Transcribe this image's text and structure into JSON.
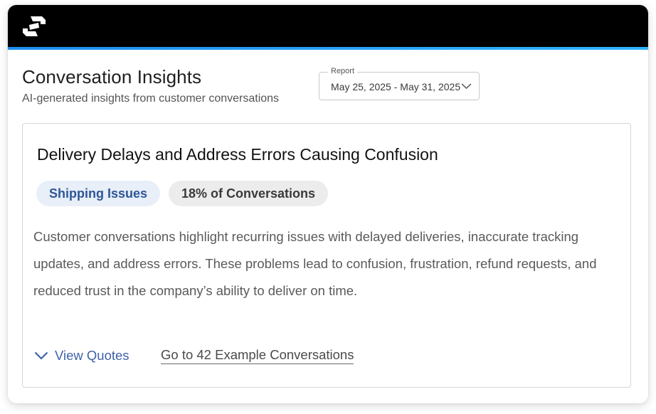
{
  "header": {
    "logo_icon": "brand-logo-icon",
    "accent_color": "#1d8df0"
  },
  "page": {
    "title": "Conversation Insights",
    "subtitle": "AI-generated insights from customer conversations"
  },
  "report": {
    "label": "Report",
    "value": "May 25, 2025 - May 31, 2025",
    "icon": "chevron-down-icon"
  },
  "insight": {
    "title": "Delivery Delays and Address Errors Causing Confusion",
    "category": "Shipping Issues",
    "share": "18% of Conversations",
    "summary": "Customer conversations highlight recurring issues with delayed deliveries, inaccurate tracking updates, and address errors. These problems lead to confusion, frustration, refund requests, and reduced trust in the company’s ability to deliver on time.",
    "view_quotes_label": "View Quotes",
    "view_quotes_icon": "chevron-down-icon",
    "example_link_label": "Go to 42 Example Conversations",
    "category_color": "#2f5698",
    "link_color": "#3f62a8"
  }
}
